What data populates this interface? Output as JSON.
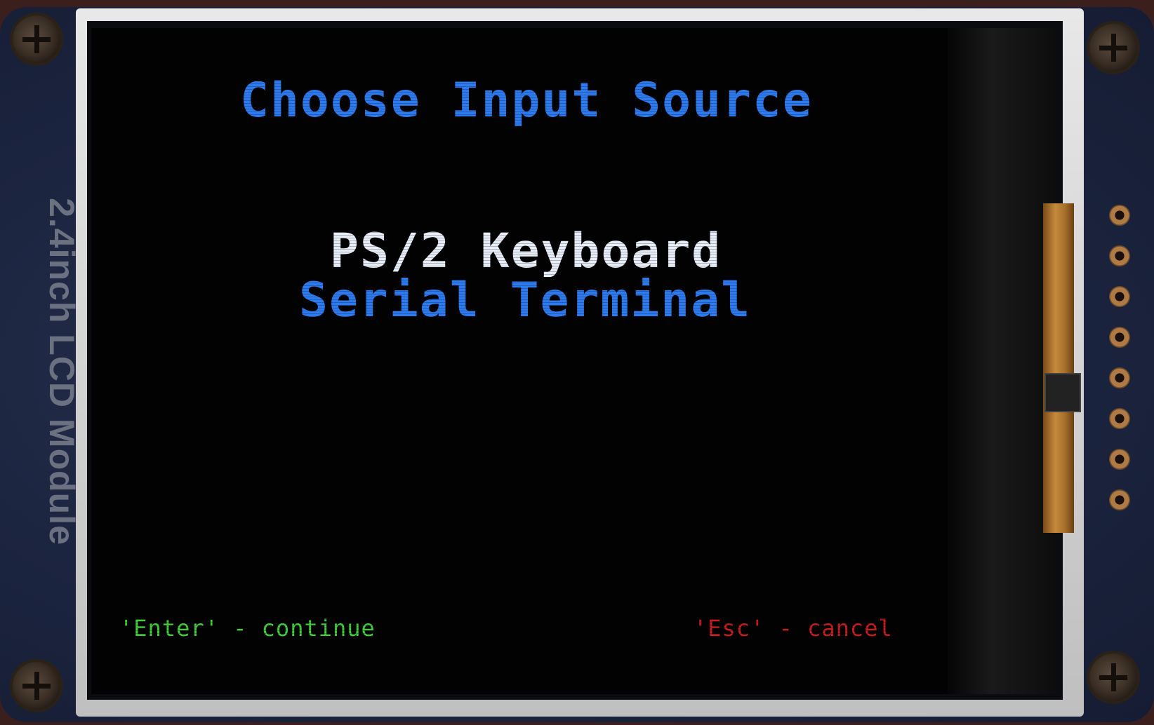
{
  "board": {
    "module_label": "2.4inch LCD Module"
  },
  "screen": {
    "title": "Choose Input Source",
    "options": [
      {
        "label": "PS/2 Keyboard",
        "selected": true
      },
      {
        "label": "Serial Terminal",
        "selected": false
      }
    ],
    "hint_continue": "'Enter' - continue",
    "hint_cancel": "'Esc' - cancel"
  },
  "colors": {
    "title": "#2e7bf0",
    "option_selected": "#e8eef8",
    "option_normal": "#2e7bf0",
    "hint_continue": "#3fd03a",
    "hint_cancel": "#c81e1e",
    "screen_bg": "#020203"
  },
  "icons": [
    "screw-icon",
    "header-pin-icon"
  ]
}
